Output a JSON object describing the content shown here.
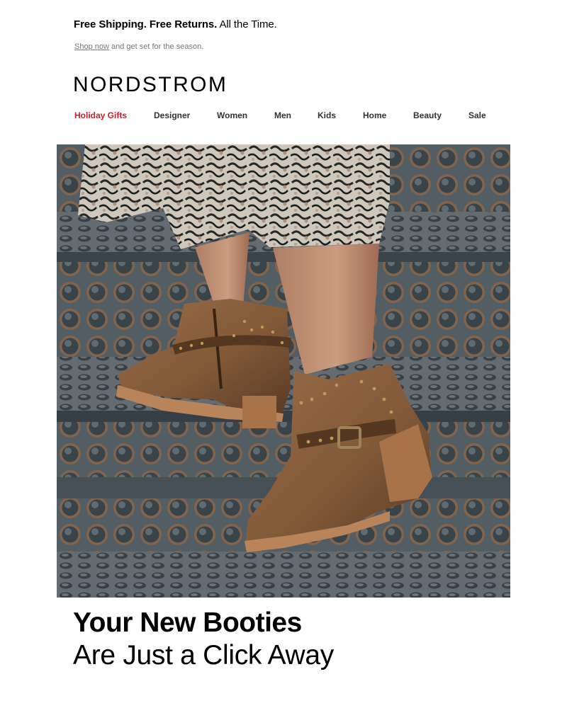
{
  "promo": {
    "bold": "Free Shipping. Free Returns.",
    "rest": "All the Time."
  },
  "sub": {
    "link": "Shop now",
    "rest": "and get set for the season."
  },
  "brand": {
    "logo": "NORDSTROM"
  },
  "nav": [
    {
      "label": "Holiday Gifts",
      "highlight": true
    },
    {
      "label": "Designer"
    },
    {
      "label": "Women"
    },
    {
      "label": "Men"
    },
    {
      "label": "Kids"
    },
    {
      "label": "Home"
    },
    {
      "label": "Beauty"
    },
    {
      "label": "Sale"
    }
  ],
  "hero": {
    "subject": "woman-in-suede-booties-on-metal-stairs",
    "colors": {
      "suede": "#8a5f3c",
      "stair": "#4f5860",
      "accent": "#c7222a"
    }
  },
  "headline": {
    "line1": "Your New Booties",
    "line2": "Are Just a Click Away"
  }
}
